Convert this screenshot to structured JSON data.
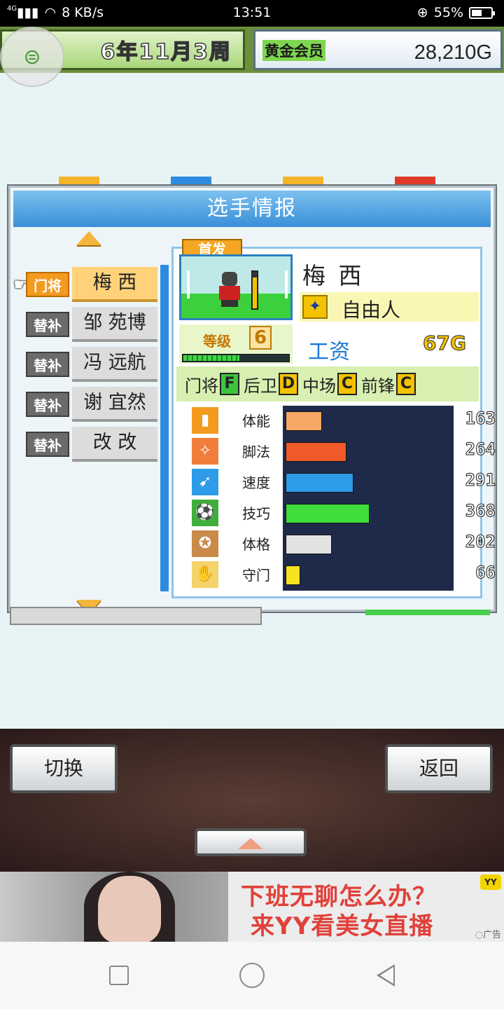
{
  "status_bar": {
    "network": "4G",
    "speed": "8 KB/s",
    "time": "13:51",
    "battery": "55%"
  },
  "top_bar": {
    "date": "6年11月3周",
    "membership": "黄金会员",
    "gold": "28,210G"
  },
  "panel": {
    "title": "选手情报"
  },
  "player_list": [
    {
      "tag": "门将",
      "name": "梅 西",
      "selected": true
    },
    {
      "tag": "替补",
      "name": "邹 苑博",
      "selected": false
    },
    {
      "tag": "替补",
      "name": "冯 远航",
      "selected": false
    },
    {
      "tag": "替补",
      "name": "谢 宜然",
      "selected": false
    },
    {
      "tag": "替补",
      "name": "改 改",
      "selected": false
    }
  ],
  "detail": {
    "badge": "首发",
    "name": "梅 西",
    "status": "自由人",
    "level_label": "等级",
    "level": "6",
    "salary_label": "工资",
    "salary": "67G",
    "positions": [
      {
        "label": "门将",
        "grade": "F"
      },
      {
        "label": "后卫",
        "grade": "D"
      },
      {
        "label": "中场",
        "grade": "C"
      },
      {
        "label": "前锋",
        "grade": "C"
      }
    ],
    "stats": [
      {
        "label": "体能",
        "value": "163",
        "ratio": 0.22,
        "color": "#f7a765",
        "icon": "battery-icon"
      },
      {
        "label": "脚法",
        "value": "264",
        "ratio": 0.37,
        "color": "#f05a2a",
        "icon": "kick-icon"
      },
      {
        "label": "速度",
        "value": "291",
        "ratio": 0.41,
        "color": "#2d9be8",
        "icon": "running-icon"
      },
      {
        "label": "技巧",
        "value": "368",
        "ratio": 0.51,
        "color": "#3fdc3a",
        "icon": "dribble-icon"
      },
      {
        "label": "体格",
        "value": "202",
        "ratio": 0.28,
        "color": "#e2e2e2",
        "icon": "muscle-icon"
      },
      {
        "label": "守门",
        "value": "66",
        "ratio": 0.09,
        "color": "#f5e221",
        "icon": "glove-icon"
      }
    ]
  },
  "buttons": {
    "switch": "切换",
    "back": "返回"
  },
  "ad": {
    "line1": "下班无聊怎么办？",
    "line2": "来YY看美女直播",
    "brand": "YY",
    "mark": "广告"
  }
}
